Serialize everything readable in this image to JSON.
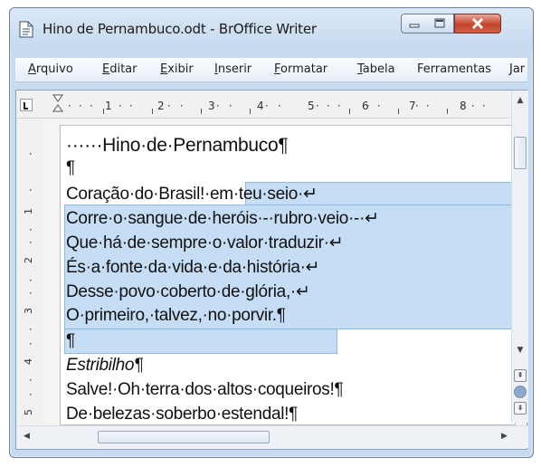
{
  "window": {
    "title": "Hino de Pernambuco.odt - BrOffice Writer",
    "icons": {
      "document": "document-icon",
      "minimize": "minimize-icon",
      "maximize": "maximize-icon",
      "close": "close-icon"
    }
  },
  "menubar": {
    "items": [
      {
        "mnemonic": "A",
        "rest": "rquivo"
      },
      {
        "mnemonic": "E",
        "rest": "ditar"
      },
      {
        "mnemonic": "E",
        "rest": "xibir"
      },
      {
        "mnemonic": "I",
        "rest": "nserir"
      },
      {
        "mnemonic": "F",
        "rest": "ormatar"
      },
      {
        "mnemonic": "T",
        "rest": "abela"
      },
      {
        "mnemonic": "",
        "rest": "Ferramentas"
      },
      {
        "mnemonic": "",
        "rest": "Jar"
      }
    ]
  },
  "ruler": {
    "horizontal_numbers": [
      "1",
      "2",
      "3",
      "4",
      "5",
      "6",
      "7",
      "8"
    ],
    "vertical_numbers": [
      "1",
      "2",
      "3",
      "4",
      "5"
    ]
  },
  "document": {
    "lines": [
      "······Hino·de·Pernambuco¶",
      "¶",
      "Coração·do·Brasil!·em·teu·seio·↵",
      "Corre·o·sangue·de·heróis·-·rubro·veio·-·↵",
      "Que·há·de·sempre·o·valor·traduzir·↵",
      "És·a·fonte·da·vida·e·da·história·↵",
      "Desse·povo·coberto·de·glória,·↵",
      "O·primeiro,·talvez,·no·porvir.¶",
      "¶",
      "Estribilho¶",
      "Salve!·Oh·terra·dos·altos·coqueiros!¶",
      "De·belezas·soberbo·estendal!¶"
    ]
  },
  "scrollbars": {
    "vertical": {
      "up_icon": "scroll-up-icon",
      "down_icon": "scroll-down-icon",
      "prev_page_icon": "previous-page-icon",
      "navigator_icon": "navigator-icon",
      "next_page_icon": "next-page-icon"
    },
    "horizontal": {
      "left_icon": "scroll-left-icon",
      "right_icon": "scroll-right-icon"
    }
  }
}
